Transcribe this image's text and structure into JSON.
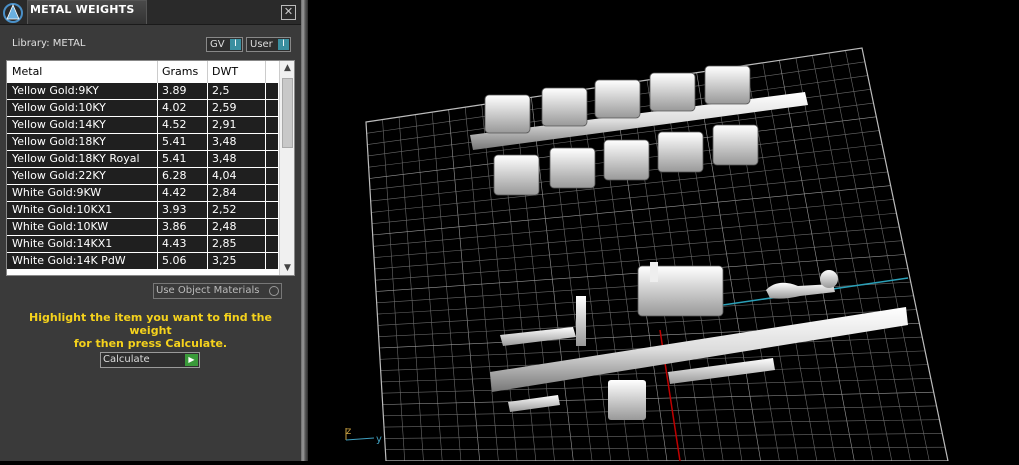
{
  "window": {
    "title": "METAL WEIGHTS",
    "close_glyph": "✕"
  },
  "library": {
    "label": "Library: METAL"
  },
  "toggles": [
    {
      "label": "GV",
      "indicator": "I"
    },
    {
      "label": "User",
      "indicator": "I"
    }
  ],
  "table": {
    "headers": {
      "metal": "Metal",
      "grams": "Grams",
      "dwt": "DWT"
    },
    "rows": [
      {
        "metal": "Yellow Gold:9KY",
        "grams": "3.89",
        "dwt": "2,5"
      },
      {
        "metal": "Yellow Gold:10KY",
        "grams": "4.02",
        "dwt": "2,59"
      },
      {
        "metal": "Yellow Gold:14KY",
        "grams": "4.52",
        "dwt": "2,91"
      },
      {
        "metal": "Yellow Gold:18KY",
        "grams": "5.41",
        "dwt": "3,48"
      },
      {
        "metal": "Yellow Gold:18KY Royal",
        "grams": "5.41",
        "dwt": "3,48"
      },
      {
        "metal": "Yellow Gold:22KY",
        "grams": "6.28",
        "dwt": "4,04"
      },
      {
        "metal": "White Gold:9KW",
        "grams": "4.42",
        "dwt": "2,84"
      },
      {
        "metal": "White Gold:10KX1",
        "grams": "3.93",
        "dwt": "2,52"
      },
      {
        "metal": "White Gold:10KW",
        "grams": "3.86",
        "dwt": "2,48"
      },
      {
        "metal": "White Gold:14KX1",
        "grams": "4.43",
        "dwt": "2,85"
      },
      {
        "metal": "White Gold:14K PdW",
        "grams": "5.06",
        "dwt": "3,25"
      }
    ]
  },
  "options": {
    "use_object_materials": "Use Object Materials"
  },
  "hint": {
    "line1": "Highlight the item you want to find the weight",
    "line2": "for then press Calculate."
  },
  "calculate": {
    "label": "Calculate",
    "indicator": "▶"
  },
  "viewport": {
    "axis_z": "z",
    "axis_y": "y"
  },
  "colors": {
    "accent_teal": "#3a8fa0",
    "hint_yellow": "#f5d21c",
    "calc_green": "#3a9a3a",
    "axis_red": "#c00000",
    "axis_cyan": "#2aa0b8"
  }
}
